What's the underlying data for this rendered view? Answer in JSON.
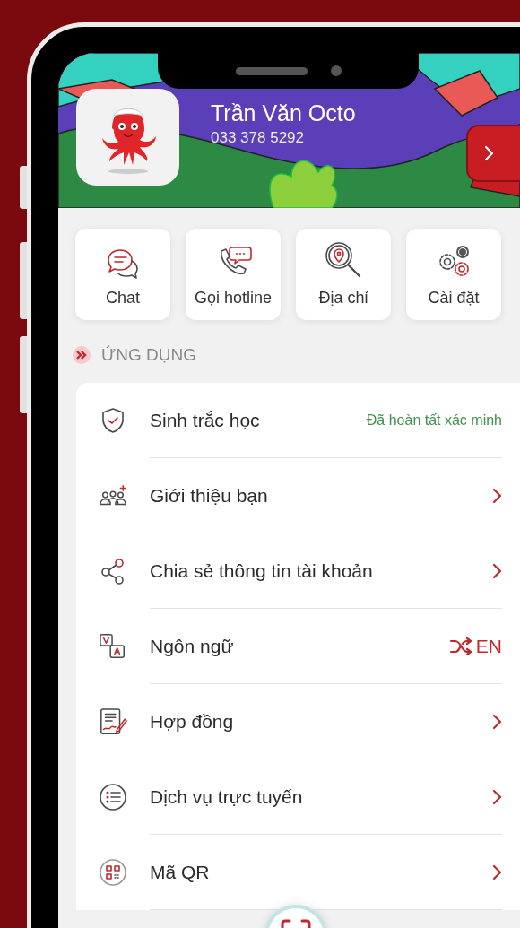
{
  "profile": {
    "name": "Trần Văn Octo",
    "phone": "033 378 5292"
  },
  "quick_actions": [
    {
      "label": "Chat"
    },
    {
      "label": "Gọi hotline"
    },
    {
      "label": "Địa chỉ"
    },
    {
      "label": "Cài đặt"
    }
  ],
  "section_title": "ỨNG DỤNG",
  "menu": [
    {
      "label": "Sinh trắc học",
      "kind": "status",
      "value": "Đã hoàn tất xác minh"
    },
    {
      "label": "Giới thiệu bạn",
      "kind": "link"
    },
    {
      "label": "Chia sẻ thông tin tài khoản",
      "kind": "link"
    },
    {
      "label": "Ngôn ngữ",
      "kind": "language",
      "value": "EN"
    },
    {
      "label": "Hợp đồng",
      "kind": "link"
    },
    {
      "label": "Dịch vụ trực tuyến",
      "kind": "link"
    },
    {
      "label": "Mã QR",
      "kind": "link"
    }
  ]
}
